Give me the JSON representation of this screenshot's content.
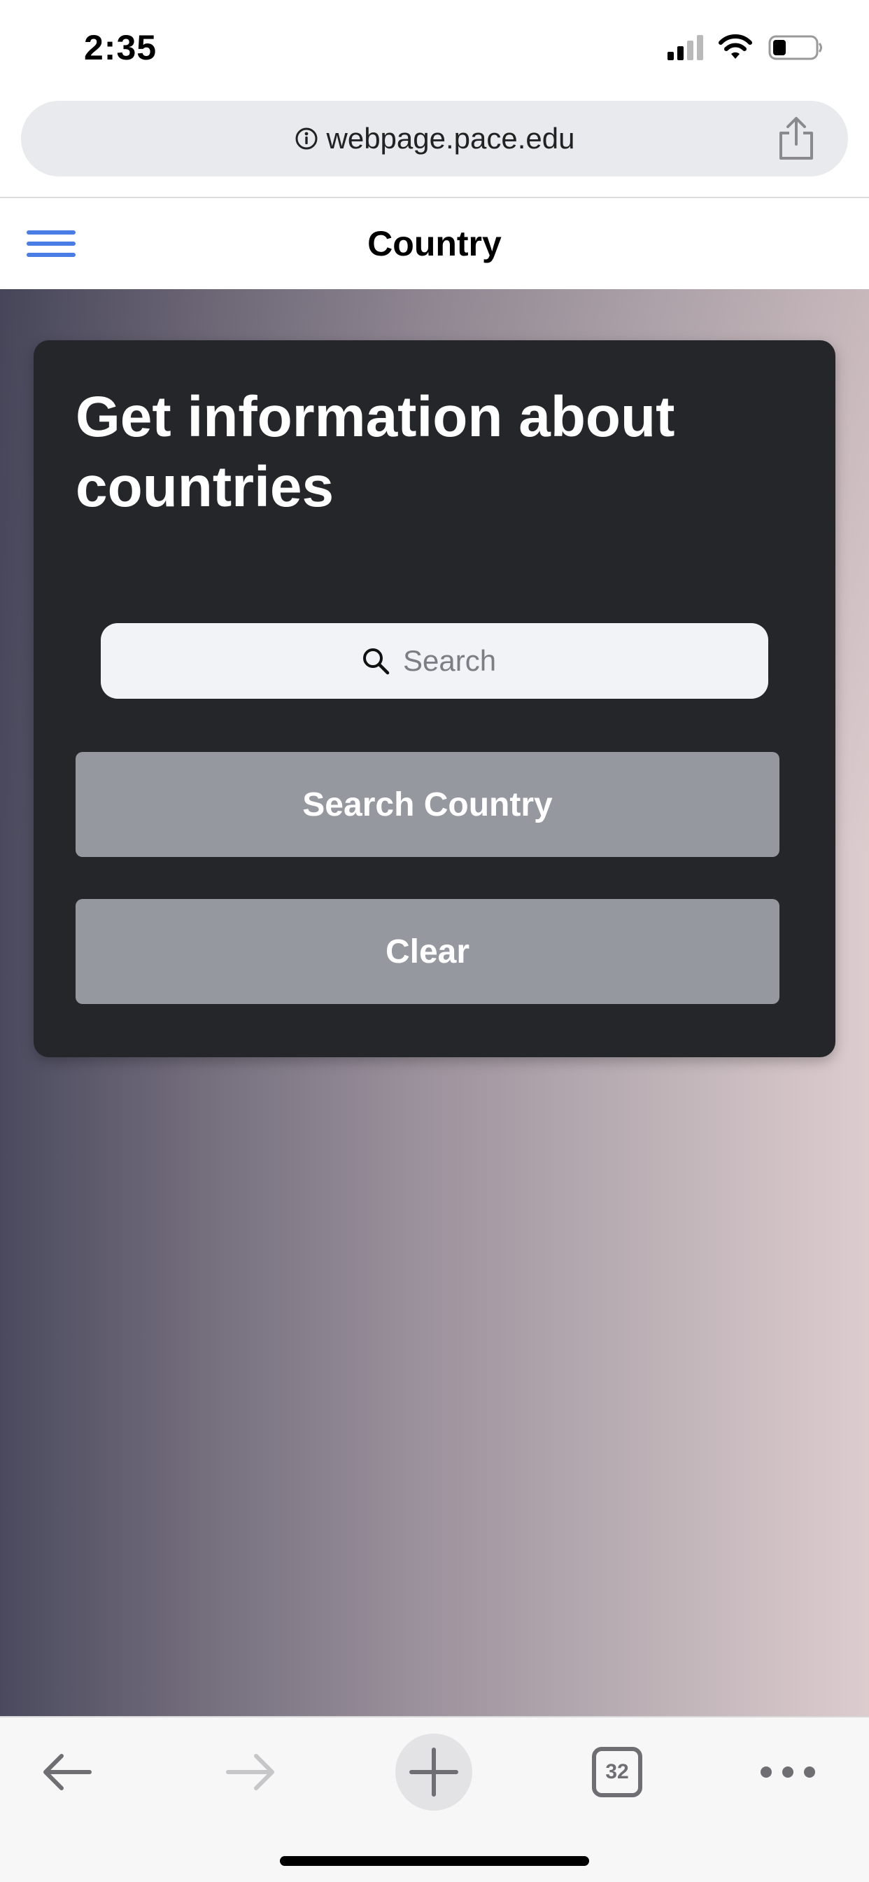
{
  "status_bar": {
    "time": "2:35",
    "icons": [
      "cellular-signal-icon",
      "wifi-icon",
      "battery-icon"
    ]
  },
  "browser": {
    "url": "webpage.pace.edu",
    "icons": [
      "info-icon",
      "share-icon"
    ],
    "toolbar": {
      "icons": [
        "back-arrow-icon",
        "forward-arrow-icon",
        "plus-icon",
        "tabs-icon",
        "more-icon"
      ],
      "tab_count": "32"
    }
  },
  "app": {
    "title": "Country",
    "menu_icon": "hamburger-menu-icon"
  },
  "card": {
    "heading": "Get information about countries",
    "search": {
      "placeholder": "Search",
      "value": "",
      "icon": "search-icon"
    },
    "search_button_label": "Search Country",
    "clear_button_label": "Clear"
  },
  "colors": {
    "accent_blue": "#4a7de6",
    "card_background": "#25262a",
    "button_background": "#9698a0",
    "search_field_background": "#f2f3f7",
    "gradient_left": "#4a4a5e",
    "gradient_right": "#ddcccd"
  }
}
